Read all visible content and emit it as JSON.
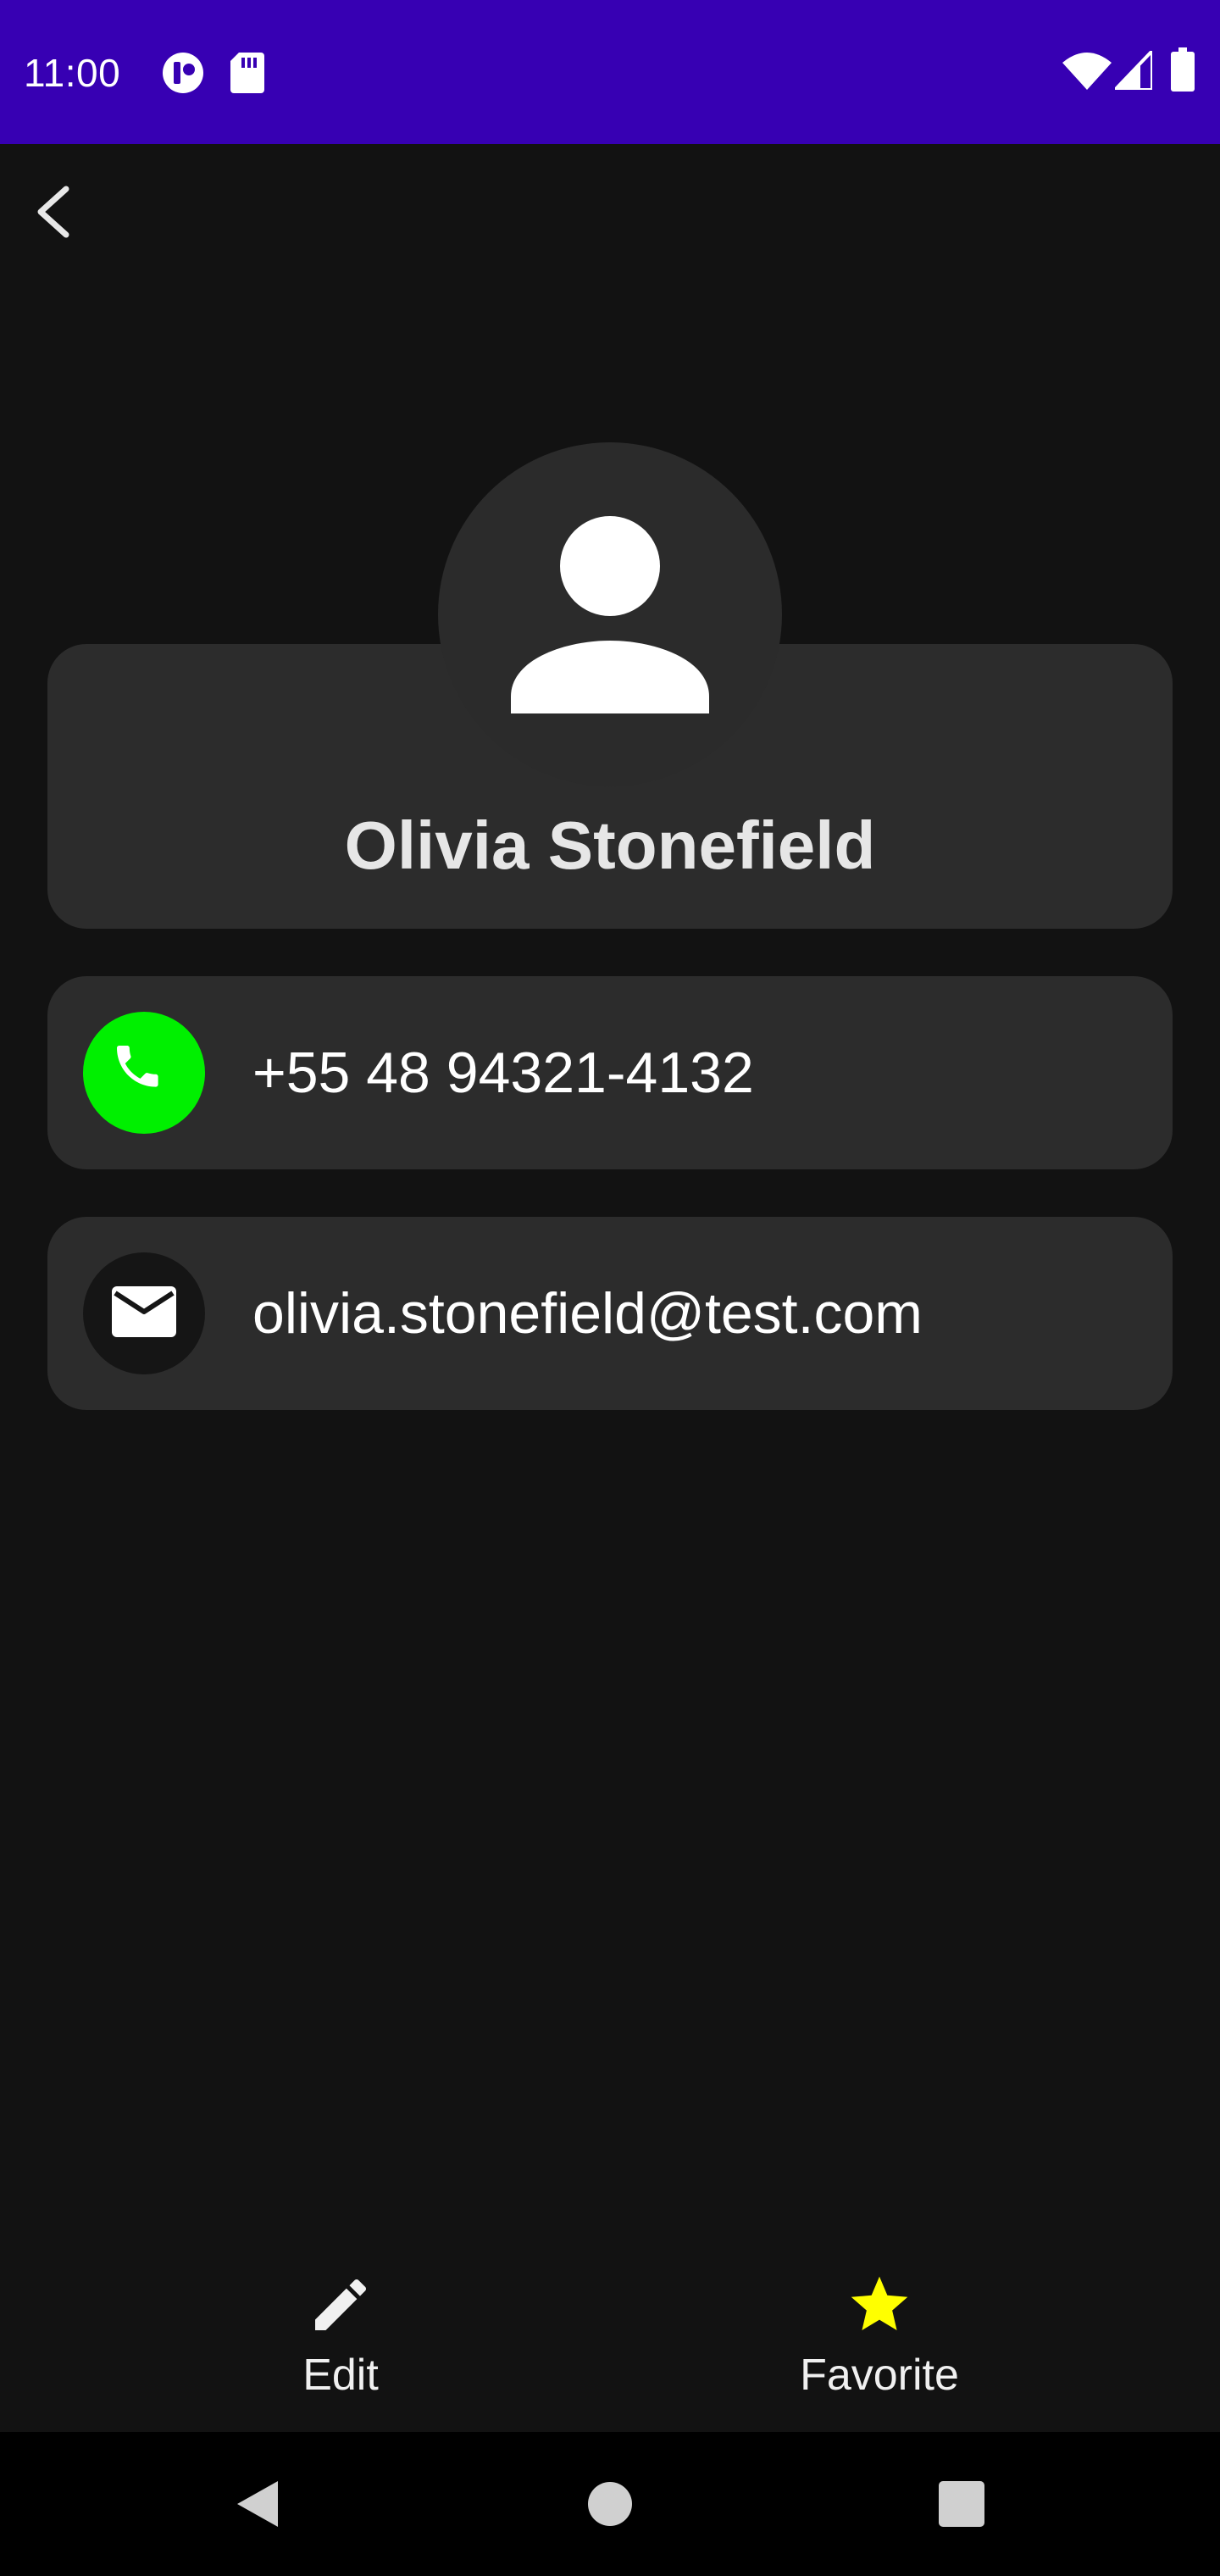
{
  "status_bar": {
    "time": "11:00",
    "background": "#3700B3",
    "left_icons": [
      "app-notification-icon",
      "sd-card-icon"
    ],
    "right_icons": [
      "wifi-icon",
      "cell-signal-icon",
      "battery-icon"
    ]
  },
  "top_bar": {
    "back_icon": "chevron-left-icon"
  },
  "contact": {
    "avatar_icon": "person-icon",
    "name": "Olivia Stonefield",
    "phone": {
      "icon": "phone-icon",
      "value": "+55 48 94321-4132",
      "icon_background": "#00F000"
    },
    "email": {
      "icon": "mail-icon",
      "value": "olivia.stonefield@test.com",
      "icon_background": "#151515"
    }
  },
  "actions": {
    "edit": {
      "label": "Edit",
      "icon": "pencil-icon"
    },
    "favorite": {
      "label": "Favorite",
      "icon": "star-icon",
      "icon_color": "#FFFF00"
    }
  },
  "nav_bar": {
    "buttons": [
      "nav-back-icon",
      "nav-home-icon",
      "nav-recents-icon"
    ]
  },
  "colors": {
    "background": "#121212",
    "card": "#2C2C2C",
    "avatar_circle": "#2B2B2B"
  }
}
